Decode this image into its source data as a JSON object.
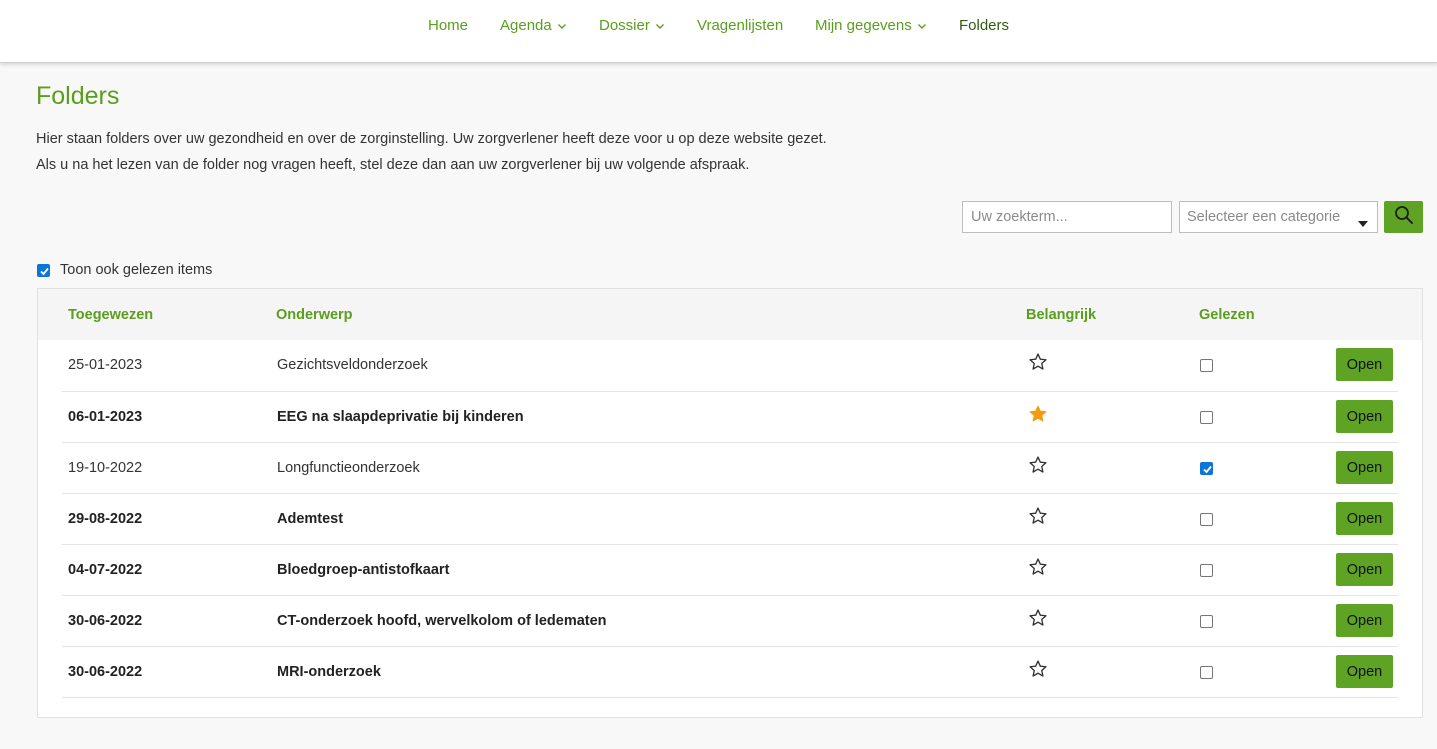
{
  "nav": {
    "items": [
      {
        "label": "Home",
        "dropdown": false
      },
      {
        "label": "Agenda",
        "dropdown": true
      },
      {
        "label": "Dossier",
        "dropdown": true
      },
      {
        "label": "Vragenlijsten",
        "dropdown": false
      },
      {
        "label": "Mijn gegevens",
        "dropdown": true
      },
      {
        "label": "Folders",
        "dropdown": false,
        "active": true
      }
    ]
  },
  "page": {
    "title": "Folders",
    "intro_line1": "Hier staan folders over uw gezondheid en over de zorginstelling. Uw zorgverlener heeft deze voor u op deze website gezet.",
    "intro_line2": "Als u na het lezen van de folder nog vragen heeft, stel deze dan aan uw zorgverlener bij uw volgende afspraak."
  },
  "search": {
    "placeholder": "Uw zoekterm...",
    "value": "",
    "category_placeholder": "Selecteer een categorie",
    "button_icon": "search-icon"
  },
  "filter": {
    "show_read_label": "Toon ook gelezen items",
    "show_read_checked": true
  },
  "table": {
    "headers": {
      "assigned": "Toegewezen",
      "subject": "Onderwerp",
      "important": "Belangrijk",
      "read": "Gelezen"
    },
    "rows": [
      {
        "date": "25-01-2023",
        "subject": "Gezichtsveldonderzoek",
        "important": false,
        "read": false,
        "bold": false,
        "action": "Open"
      },
      {
        "date": "06-01-2023",
        "subject": "EEG na slaapdeprivatie bij kinderen",
        "important": true,
        "read": false,
        "bold": true,
        "action": "Open"
      },
      {
        "date": "19-10-2022",
        "subject": "Longfunctieonderzoek",
        "important": false,
        "read": true,
        "bold": false,
        "action": "Open"
      },
      {
        "date": "29-08-2022",
        "subject": "Ademtest",
        "important": false,
        "read": false,
        "bold": true,
        "action": "Open"
      },
      {
        "date": "04-07-2022",
        "subject": "Bloedgroep-antistofkaart",
        "important": false,
        "read": false,
        "bold": true,
        "action": "Open"
      },
      {
        "date": "30-06-2022",
        "subject": "CT-onderzoek hoofd, wervelkolom of ledematen",
        "important": false,
        "read": false,
        "bold": true,
        "action": "Open"
      },
      {
        "date": "30-06-2022",
        "subject": "MRI-onderzoek",
        "important": false,
        "read": false,
        "bold": true,
        "action": "Open"
      }
    ]
  },
  "colors": {
    "accent": "#5a9e1e",
    "button": "#5ea323",
    "star_filled": "#f39c12",
    "checkbox_checked": "#0b76d8"
  }
}
